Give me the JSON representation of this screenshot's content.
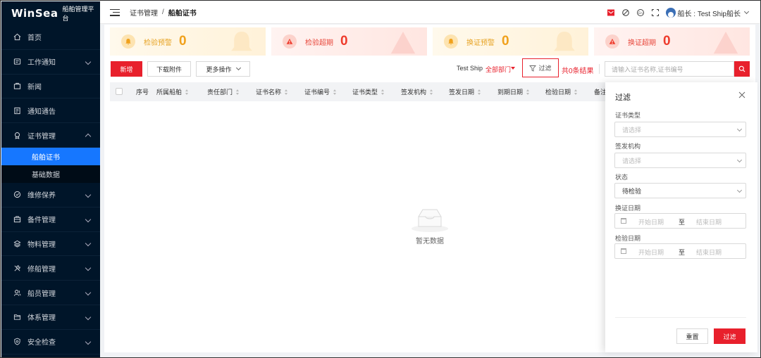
{
  "brand": {
    "name": "WinSea",
    "subtitle": "船舶管理平台"
  },
  "sidebar": {
    "items": [
      {
        "label": "首页",
        "icon": "home-icon",
        "expandable": false
      },
      {
        "label": "工作通知",
        "icon": "message-icon",
        "expandable": true
      },
      {
        "label": "新闻",
        "icon": "news-icon",
        "expandable": false
      },
      {
        "label": "通知通告",
        "icon": "notice-icon",
        "expandable": false
      },
      {
        "label": "证书管理",
        "icon": "certificate-icon",
        "expandable": true,
        "expanded": true,
        "children": [
          {
            "label": "船舶证书",
            "active": true
          },
          {
            "label": "基础数据",
            "active": false
          }
        ]
      },
      {
        "label": "维修保养",
        "icon": "maintenance-icon",
        "expandable": true
      },
      {
        "label": "备件管理",
        "icon": "parts-icon",
        "expandable": true
      },
      {
        "label": "物料管理",
        "icon": "materials-icon",
        "expandable": true
      },
      {
        "label": "修船管理",
        "icon": "repair-icon",
        "expandable": true
      },
      {
        "label": "船员管理",
        "icon": "crew-icon",
        "expandable": true
      },
      {
        "label": "体系管理",
        "icon": "system-icon",
        "expandable": true
      },
      {
        "label": "安全检查",
        "icon": "safety-icon",
        "expandable": true
      }
    ]
  },
  "header": {
    "breadcrumb": [
      "证书管理",
      "船舶证书"
    ],
    "separator": "/",
    "user": "船长 : Test Ship船长"
  },
  "stats": [
    {
      "label": "检验预警",
      "value": "0",
      "kind": "warn",
      "icon": "bell-icon"
    },
    {
      "label": "检验超期",
      "value": "0",
      "kind": "alert",
      "icon": "warning-icon"
    },
    {
      "label": "换证预警",
      "value": "0",
      "kind": "warn",
      "icon": "bell-icon"
    },
    {
      "label": "换证超期",
      "value": "0",
      "kind": "alert",
      "icon": "warning-icon"
    }
  ],
  "toolbar": {
    "add_label": "新增",
    "download_label": "下载附件",
    "more_label": "更多操作",
    "ship": "Test Ship",
    "dept": "全部部门",
    "filter_label": "过滤",
    "result": "共0条结果",
    "search_placeholder": "请输入证书名称,证书编号"
  },
  "table": {
    "columns": [
      "序号",
      "所属船舶",
      "责任部门",
      "证书名称",
      "证书编号",
      "证书类型",
      "签发机构",
      "签发日期",
      "到期日期",
      "检验日期",
      "备注"
    ],
    "empty_text": "暂无数据"
  },
  "drawer": {
    "title": "过滤",
    "fields": [
      {
        "label": "证书类型",
        "type": "select",
        "placeholder": "请选择",
        "value": ""
      },
      {
        "label": "签发机构",
        "type": "select",
        "placeholder": "请选择",
        "value": ""
      },
      {
        "label": "状态",
        "type": "select",
        "placeholder": "",
        "value": "待检验"
      },
      {
        "label": "换证日期",
        "type": "range",
        "start": "开始日期",
        "to": "至",
        "end": "结束日期"
      },
      {
        "label": "检验日期",
        "type": "range",
        "start": "开始日期",
        "to": "至",
        "end": "结束日期"
      }
    ],
    "reset_label": "重置",
    "apply_label": "过滤"
  },
  "colors": {
    "primary": "#e8202c",
    "sidebar_bg": "#001529",
    "active": "#1677ff",
    "warn": "#f0a11c",
    "alert": "#ee3b2c"
  }
}
